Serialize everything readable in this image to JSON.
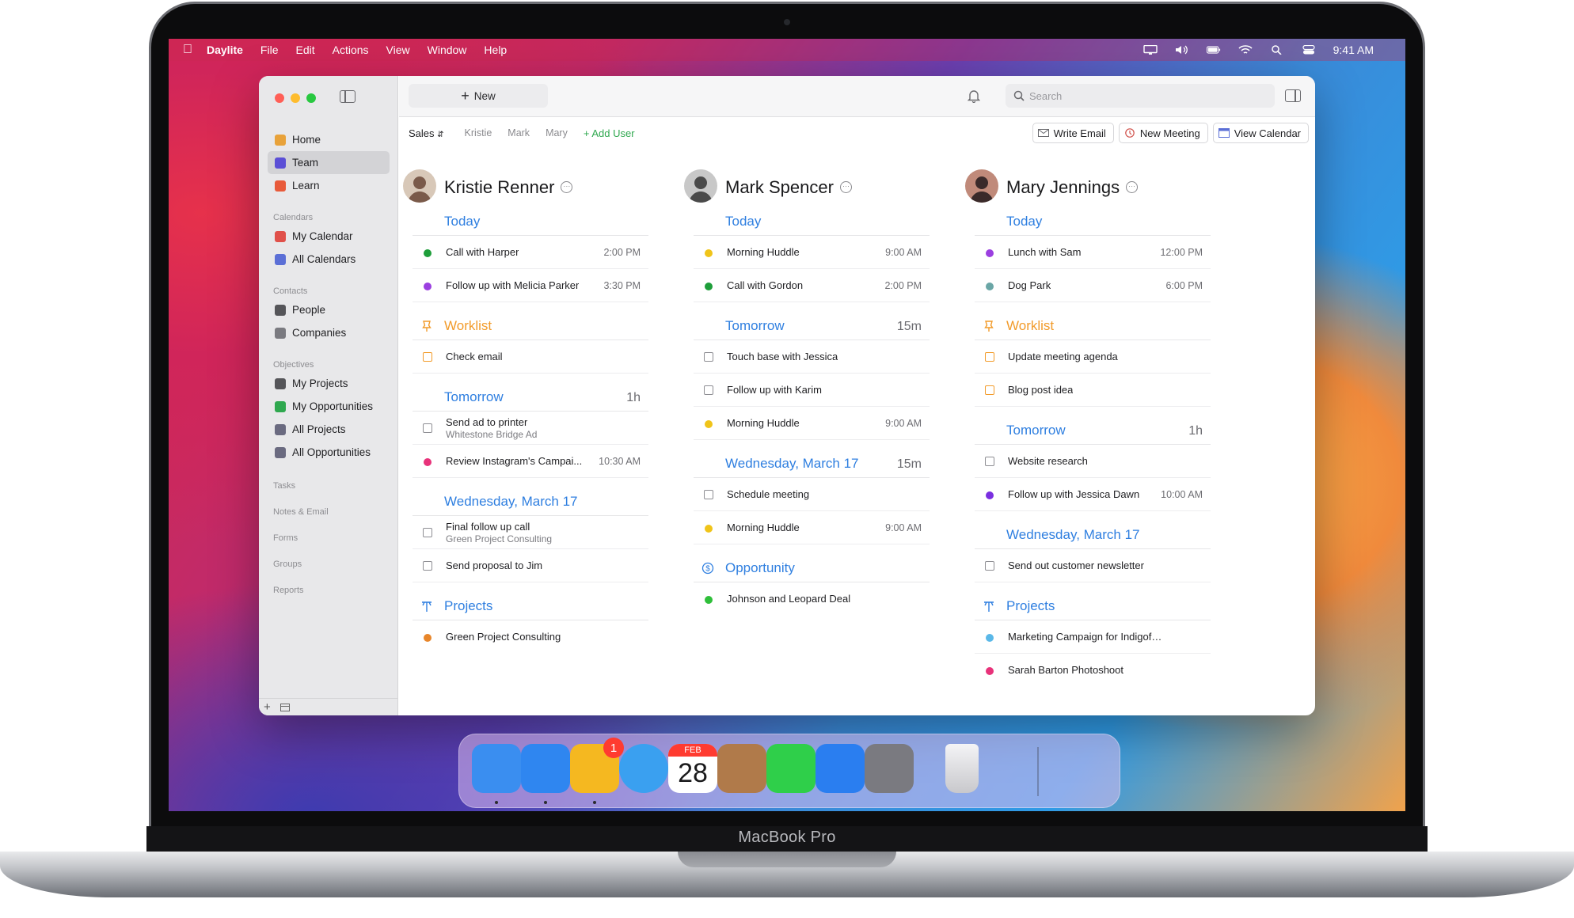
{
  "device": {
    "brand": "MacBook Pro"
  },
  "menubar": {
    "app": "Daylite",
    "items": [
      "File",
      "Edit",
      "Actions",
      "View",
      "Window",
      "Help"
    ],
    "clock": "9:41 AM"
  },
  "toolbar": {
    "new_label": "New",
    "search_placeholder": "Search"
  },
  "sidebar": {
    "main": [
      {
        "label": "Home",
        "icon": "home-icon",
        "color": "#e8a23a"
      },
      {
        "label": "Team",
        "icon": "team-icon",
        "color": "#5b4fd6"
      },
      {
        "label": "Learn",
        "icon": "books-icon",
        "color": "#e85a3a"
      }
    ],
    "calendars_header": "Calendars",
    "calendars": [
      {
        "label": "My Calendar",
        "icon": "calendar-icon",
        "color": "#e0504a"
      },
      {
        "label": "All Calendars",
        "icon": "calendars-icon",
        "color": "#5b6fd6"
      }
    ],
    "contacts_header": "Contacts",
    "contacts": [
      {
        "label": "People",
        "icon": "person-icon",
        "color": "#555559"
      },
      {
        "label": "Companies",
        "icon": "building-icon",
        "color": "#7a7a80"
      }
    ],
    "objectives_header": "Objectives",
    "objectives": [
      {
        "label": "My Projects",
        "icon": "project-icon",
        "color": "#555559"
      },
      {
        "label": "My Opportunities",
        "icon": "dollar-icon",
        "color": "#2fa84f"
      },
      {
        "label": "All Projects",
        "icon": "all-projects-icon",
        "color": "#6a6a80"
      },
      {
        "label": "All Opportunities",
        "icon": "all-opportunities-icon",
        "color": "#6a6a80"
      }
    ],
    "extra_sections": [
      "Tasks",
      "Notes & Email",
      "Forms",
      "Groups",
      "Reports"
    ]
  },
  "subbar": {
    "filter": "Sales",
    "users": [
      "Kristie",
      "Mark",
      "Mary"
    ],
    "add_user": "Add User",
    "write_email": "Write Email",
    "new_meeting": "New Meeting",
    "view_calendar": "View Calendar"
  },
  "columns": [
    {
      "name": "Kristie Renner",
      "sections": [
        {
          "title": "Today",
          "kind": "day",
          "meta": "",
          "rows": [
            {
              "type": "event",
              "color": "#1e9e3a",
              "title": "Call with Harper",
              "time": "2:00 PM"
            },
            {
              "type": "event",
              "color": "#9b3fe0",
              "title": "Follow up with Melicia Parker",
              "time": "3:30 PM"
            }
          ]
        },
        {
          "title": "Worklist",
          "kind": "worklist",
          "meta": "",
          "rows": [
            {
              "type": "task-orange",
              "title": "Check email"
            }
          ]
        },
        {
          "title": "Tomorrow",
          "kind": "day",
          "meta": "1h",
          "rows": [
            {
              "type": "task",
              "title": "Send ad to printer",
              "sub": "Whitestone Bridge Ad"
            },
            {
              "type": "event",
              "color": "#e8327a",
              "title": "Review Instagram's Campai...",
              "time": "10:30 AM"
            }
          ]
        },
        {
          "title": "Wednesday, March 17",
          "kind": "day",
          "meta": "",
          "rows": [
            {
              "type": "task",
              "title": "Final follow up call",
              "sub": "Green Project Consulting"
            },
            {
              "type": "task",
              "title": "Send proposal to Jim"
            }
          ]
        },
        {
          "title": "Projects",
          "kind": "projects",
          "meta": "",
          "rows": [
            {
              "type": "event",
              "color": "#e8862a",
              "title": "Green Project Consulting"
            }
          ]
        }
      ]
    },
    {
      "name": "Mark Spencer",
      "sections": [
        {
          "title": "Today",
          "kind": "day",
          "meta": "",
          "rows": [
            {
              "type": "event",
              "color": "#f0c419",
              "title": "Morning Huddle",
              "time": "9:00 AM"
            },
            {
              "type": "event",
              "color": "#1e9e3a",
              "title": "Call with Gordon",
              "time": "2:00 PM"
            }
          ]
        },
        {
          "title": "Tomorrow",
          "kind": "day",
          "meta": "15m",
          "rows": [
            {
              "type": "task",
              "title": "Touch base with Jessica"
            },
            {
              "type": "task",
              "title": "Follow up with Karim"
            },
            {
              "type": "event",
              "color": "#f0c419",
              "title": "Morning Huddle",
              "time": "9:00 AM"
            }
          ]
        },
        {
          "title": "Wednesday, March 17",
          "kind": "day",
          "meta": "15m",
          "rows": [
            {
              "type": "task",
              "title": "Schedule meeting"
            },
            {
              "type": "event",
              "color": "#f0c419",
              "title": "Morning Huddle",
              "time": "9:00 AM"
            }
          ]
        },
        {
          "title": "Opportunity",
          "kind": "opportunity",
          "meta": "",
          "rows": [
            {
              "type": "event",
              "color": "#2fbf3a",
              "title": "Johnson and Leopard Deal"
            }
          ]
        }
      ]
    },
    {
      "name": "Mary Jennings",
      "sections": [
        {
          "title": "Today",
          "kind": "day",
          "meta": "",
          "rows": [
            {
              "type": "event",
              "color": "#9b3fe0",
              "title": "Lunch with Sam",
              "time": "12:00 PM"
            },
            {
              "type": "event",
              "color": "#6aa6a6",
              "title": "Dog Park",
              "time": "6:00 PM"
            }
          ]
        },
        {
          "title": "Worklist",
          "kind": "worklist",
          "meta": "",
          "rows": [
            {
              "type": "task-orange",
              "title": "Update meeting agenda"
            },
            {
              "type": "task-orange",
              "title": "Blog post idea"
            }
          ]
        },
        {
          "title": "Tomorrow",
          "kind": "day",
          "meta": "1h",
          "rows": [
            {
              "type": "task",
              "title": "Website research"
            },
            {
              "type": "event",
              "color": "#7a2fe0",
              "title": "Follow up with Jessica Dawn",
              "time": "10:00 AM"
            }
          ]
        },
        {
          "title": "Wednesday, March 17",
          "kind": "day",
          "meta": "",
          "rows": [
            {
              "type": "task",
              "title": "Send out customer newsletter"
            }
          ]
        },
        {
          "title": "Projects",
          "kind": "projects",
          "meta": "",
          "rows": [
            {
              "type": "event",
              "color": "#5ab8e8",
              "title": "Marketing Campaign for Indigofera Solu..."
            },
            {
              "type": "event",
              "color": "#e8327a",
              "title": "Sarah Barton Photoshoot"
            }
          ]
        }
      ]
    }
  ],
  "dock": {
    "apps": [
      {
        "name": "finder-icon",
        "color": "#3a8ef0",
        "running": true
      },
      {
        "name": "mail-icon",
        "color": "#2f86f0",
        "running": true
      },
      {
        "name": "daylite-icon",
        "color": "#f5b820",
        "running": true,
        "badge": "1"
      },
      {
        "name": "safari-icon",
        "color": "#3aa0f0",
        "running": false
      },
      {
        "name": "calendar-icon",
        "color": "#ffffff",
        "running": false,
        "month": "FEB",
        "day": "28"
      },
      {
        "name": "contacts-icon",
        "color": "#b07a4a",
        "running": false
      },
      {
        "name": "facetime-icon",
        "color": "#2fcf4a",
        "running": false
      },
      {
        "name": "app-store-icon",
        "color": "#2a7ef0",
        "running": false
      },
      {
        "name": "system-preferences-icon",
        "color": "#7a7a80",
        "running": false
      },
      {
        "name": "trash-icon",
        "color": "#e6e6ea",
        "running": false
      }
    ]
  }
}
